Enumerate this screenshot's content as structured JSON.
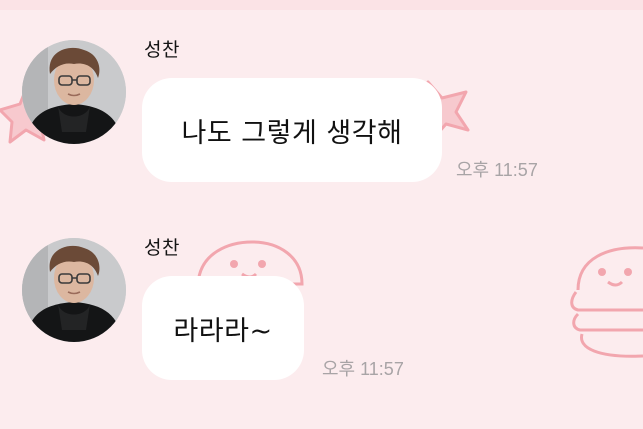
{
  "chat": {
    "messages": [
      {
        "sender": "성찬",
        "text": "나도 그렇게 생각해",
        "time": "오후 11:57",
        "avatar_icon": "profile-photo"
      },
      {
        "sender": "성찬",
        "text": "라라라~",
        "time": "오후 11:57",
        "avatar_icon": "profile-photo"
      }
    ]
  },
  "theme": {
    "background": "#fcecee",
    "bubble": "#ffffff",
    "doodle_stroke": "#f2a6ae",
    "timestamp": "#a8a4a6",
    "background_icons": [
      "star-doodle-icon",
      "burger-doodle-icon"
    ]
  }
}
